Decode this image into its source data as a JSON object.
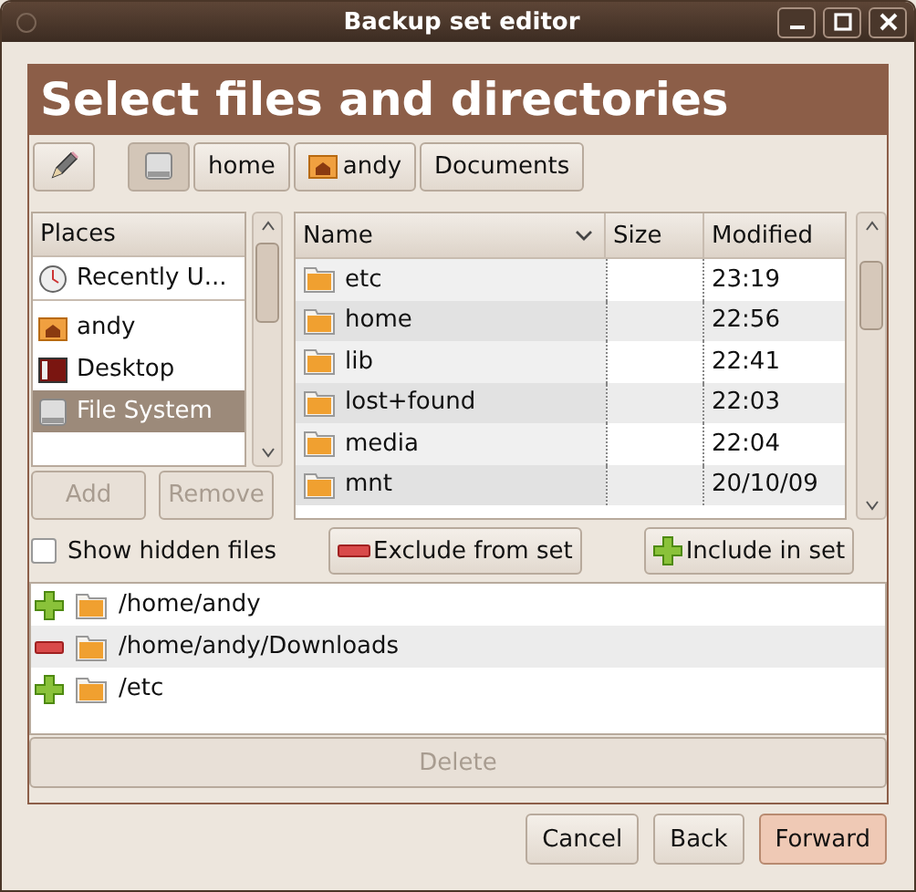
{
  "window": {
    "title": "Backup set editor"
  },
  "header": {
    "title": "Select files and directories"
  },
  "path_bar": [
    {
      "label": "home",
      "kind": "plain",
      "selected": false
    },
    {
      "label": "andy",
      "kind": "home",
      "selected": false
    },
    {
      "label": "Documents",
      "kind": "plain",
      "selected": false
    }
  ],
  "places": {
    "heading": "Places",
    "items": [
      {
        "label": "Recently U...",
        "kind": "recent",
        "selected": false
      },
      {
        "label": "andy",
        "kind": "home",
        "selected": false
      },
      {
        "label": "Desktop",
        "kind": "desktop",
        "selected": false
      },
      {
        "label": "File System",
        "kind": "drive",
        "selected": true
      }
    ],
    "buttons": [
      {
        "label": "Add",
        "disabled": true
      },
      {
        "label": "Remove",
        "disabled": true
      }
    ]
  },
  "files": {
    "columns": [
      "Name",
      "Size",
      "Modified"
    ],
    "rows": [
      {
        "name": "etc",
        "modified": "23:19"
      },
      {
        "name": "home",
        "modified": "22:56"
      },
      {
        "name": "lib",
        "modified": "22:41"
      },
      {
        "name": "lost+found",
        "modified": "22:03"
      },
      {
        "name": "media",
        "modified": "22:04"
      },
      {
        "name": "mnt",
        "modified": "20/10/09"
      }
    ]
  },
  "show_hidden": {
    "label": "Show hidden files",
    "checked": false
  },
  "actions": [
    {
      "label": "Exclude from set",
      "kind": "exclude"
    },
    {
      "label": "Include in set",
      "kind": "include"
    }
  ],
  "backup_set": [
    {
      "path": "/home/andy",
      "kind": "include"
    },
    {
      "path": "/home/andy/Downloads",
      "kind": "exclude"
    },
    {
      "path": "/etc",
      "kind": "include"
    }
  ],
  "delete_button": {
    "label": "Delete",
    "disabled": true
  },
  "dialog_buttons": [
    {
      "label": "Cancel",
      "default": false
    },
    {
      "label": "Back",
      "default": false
    },
    {
      "label": "Forward",
      "default": true
    }
  ]
}
